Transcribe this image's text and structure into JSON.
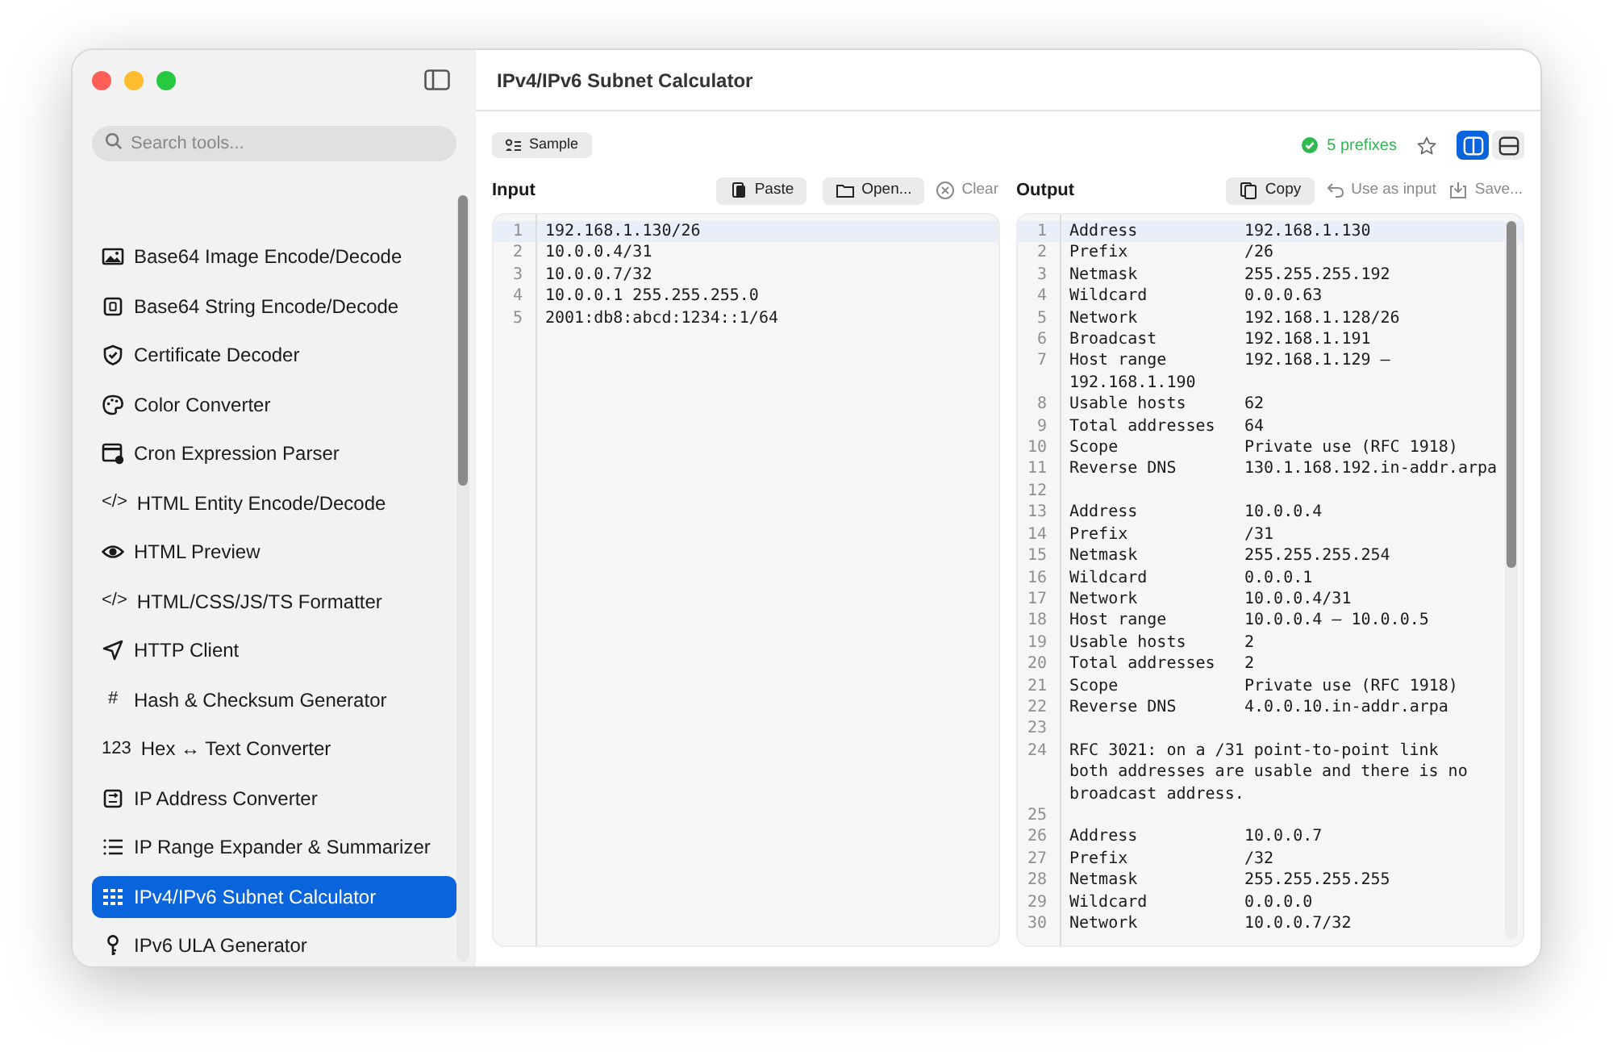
{
  "sidebar": {
    "search": {
      "placeholder": "Search tools..."
    },
    "items": [
      {
        "label": "Base64 Image Encode/Decode",
        "selected": false
      },
      {
        "label": "Base64 String Encode/Decode",
        "selected": false
      },
      {
        "label": "Certificate Decoder",
        "selected": false
      },
      {
        "label": "Color Converter",
        "selected": false
      },
      {
        "label": "Cron Expression Parser",
        "selected": false
      },
      {
        "label": "HTML Entity Encode/Decode",
        "selected": false,
        "glyph": "</>"
      },
      {
        "label": "HTML Preview",
        "selected": false
      },
      {
        "label": "HTML/CSS/JS/TS Formatter",
        "selected": false,
        "glyph": "</>"
      },
      {
        "label": "HTTP Client",
        "selected": false
      },
      {
        "label": "Hash & Checksum Generator",
        "selected": false,
        "glyph": "#"
      },
      {
        "label": "Hex ↔ Text Converter",
        "selected": false,
        "glyph": "123"
      },
      {
        "label": "IP Address Converter",
        "selected": false
      },
      {
        "label": "IP Range Expander & Summarizer",
        "selected": false
      },
      {
        "label": "IPv4/IPv6 Subnet Calculator",
        "selected": true
      },
      {
        "label": "IPv6 ULA Generator",
        "selected": false
      }
    ]
  },
  "title": "IPv4/IPv6 Subnet Calculator",
  "toolbar": {
    "sample": "Sample",
    "status": "5 prefixes",
    "favorite": false,
    "views": [
      {
        "selected": true
      },
      {
        "selected": false
      }
    ]
  },
  "input": {
    "heading": "Input",
    "actions": [
      {
        "label": "Paste",
        "kind": "filled"
      },
      {
        "label": "Open...",
        "kind": "filled"
      },
      {
        "label": "Clear",
        "kind": "plain"
      }
    ],
    "lines": [
      {
        "n": "1",
        "text": "192.168.1.130/26",
        "active": true
      },
      {
        "n": "2",
        "text": "10.0.0.4/31",
        "active": false
      },
      {
        "n": "3",
        "text": "10.0.0.7/32",
        "active": false
      },
      {
        "n": "4",
        "text": "10.0.0.1 255.255.255.0",
        "active": false
      },
      {
        "n": "5",
        "text": "2001:db8:abcd:1234::1/64",
        "active": false
      }
    ]
  },
  "output": {
    "heading": "Output",
    "actions": [
      {
        "label": "Copy",
        "kind": "filled"
      },
      {
        "label": "Use as input",
        "kind": "plain"
      },
      {
        "label": "Save...",
        "kind": "plain"
      }
    ],
    "lines": [
      {
        "n": "1",
        "kind": "field",
        "key": "Address",
        "value": "192.168.1.130",
        "active": true
      },
      {
        "n": "2",
        "kind": "field",
        "key": "Prefix",
        "value": "/26",
        "active": false
      },
      {
        "n": "3",
        "kind": "field",
        "key": "Netmask",
        "value": "255.255.255.192",
        "active": false
      },
      {
        "n": "4",
        "kind": "field",
        "key": "Wildcard",
        "value": "0.0.0.63",
        "active": false
      },
      {
        "n": "5",
        "kind": "field",
        "key": "Network",
        "value": "192.168.1.128/26",
        "active": false
      },
      {
        "n": "6",
        "kind": "field",
        "key": "Broadcast",
        "value": "192.168.1.191",
        "active": false
      },
      {
        "n": "7",
        "kind": "field",
        "key": "Host range",
        "value": "192.168.1.129 –",
        "cont": "192.168.1.190",
        "active": false
      },
      {
        "n": "8",
        "kind": "field",
        "key": "Usable hosts",
        "value": "62",
        "active": false
      },
      {
        "n": "9",
        "kind": "field",
        "key": "Total addresses",
        "value": "64",
        "active": false
      },
      {
        "n": "10",
        "kind": "field",
        "key": "Scope",
        "value": "Private use (RFC 1918)",
        "active": false
      },
      {
        "n": "11",
        "kind": "field",
        "key": "Reverse DNS",
        "value": "130.1.168.192.in-addr.arpa",
        "active": false
      },
      {
        "n": "12",
        "kind": "blank",
        "active": false
      },
      {
        "n": "13",
        "kind": "field",
        "key": "Address",
        "value": "10.0.0.4",
        "active": false
      },
      {
        "n": "14",
        "kind": "field",
        "key": "Prefix",
        "value": "/31",
        "active": false
      },
      {
        "n": "15",
        "kind": "field",
        "key": "Netmask",
        "value": "255.255.255.254",
        "active": false
      },
      {
        "n": "16",
        "kind": "field",
        "key": "Wildcard",
        "value": "0.0.0.1",
        "active": false
      },
      {
        "n": "17",
        "kind": "field",
        "key": "Network",
        "value": "10.0.0.4/31",
        "active": false
      },
      {
        "n": "18",
        "kind": "field",
        "key": "Host range",
        "value": "10.0.0.4 – 10.0.0.5",
        "active": false
      },
      {
        "n": "19",
        "kind": "field",
        "key": "Usable hosts",
        "value": "2",
        "active": false
      },
      {
        "n": "20",
        "kind": "field",
        "key": "Total addresses",
        "value": "2",
        "active": false
      },
      {
        "n": "21",
        "kind": "field",
        "key": "Scope",
        "value": "Private use (RFC 1918)",
        "active": false
      },
      {
        "n": "22",
        "kind": "field",
        "key": "Reverse DNS",
        "value": "4.0.0.10.in-addr.arpa",
        "active": false
      },
      {
        "n": "23",
        "kind": "blank",
        "active": false
      },
      {
        "n": "24",
        "kind": "note",
        "text": "RFC 3021: on a /31 point-to-point link both addresses are usable and there is no broadcast address.",
        "active": false
      },
      {
        "n": "25",
        "kind": "blank",
        "active": false
      },
      {
        "n": "26",
        "kind": "field",
        "key": "Address",
        "value": "10.0.0.7",
        "active": false
      },
      {
        "n": "27",
        "kind": "field",
        "key": "Prefix",
        "value": "/32",
        "active": false
      },
      {
        "n": "28",
        "kind": "field",
        "key": "Netmask",
        "value": "255.255.255.255",
        "active": false
      },
      {
        "n": "29",
        "kind": "field",
        "key": "Wildcard",
        "value": "0.0.0.0",
        "active": false
      },
      {
        "n": "30",
        "kind": "field",
        "key": "Network",
        "value": "10.0.0.7/32",
        "active": false
      }
    ]
  }
}
